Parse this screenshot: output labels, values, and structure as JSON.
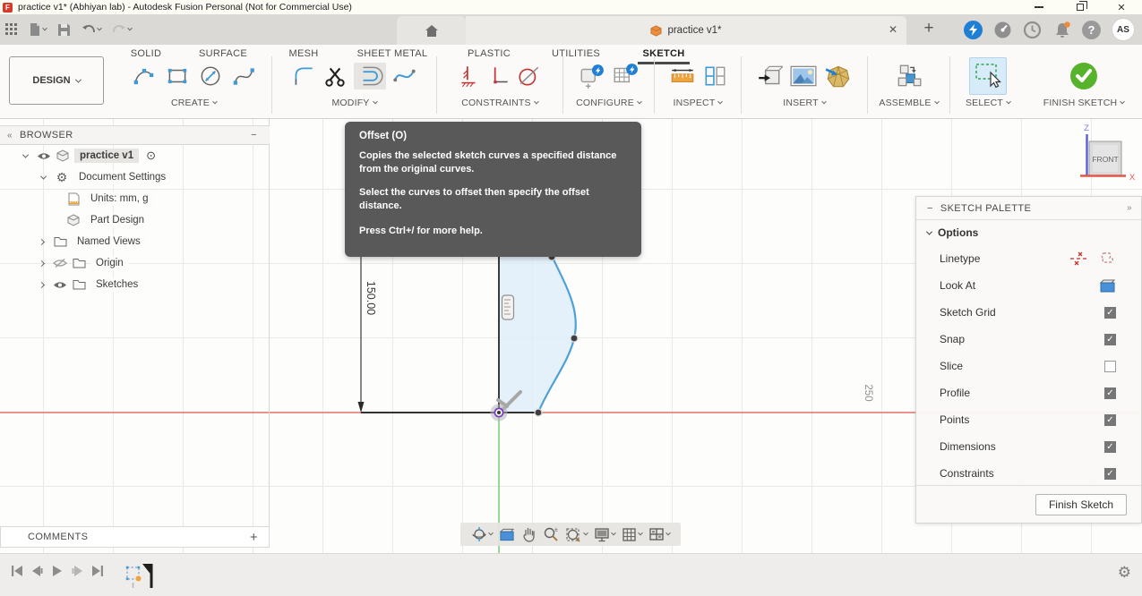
{
  "window": {
    "title": "practice v1* (Abhiyan lab) - Autodesk Fusion Personal (Not for Commercial Use)",
    "logo_letter": "F"
  },
  "tabbar": {
    "document_tab": "practice v1*",
    "close_glyph": "✕",
    "new_tab_glyph": "+",
    "help_glyph": "?",
    "avatar": "AS"
  },
  "ribbon": {
    "design_button": "DESIGN",
    "tabs": [
      {
        "label": "SOLID"
      },
      {
        "label": "SURFACE"
      },
      {
        "label": "MESH"
      },
      {
        "label": "SHEET METAL"
      },
      {
        "label": "PLASTIC"
      },
      {
        "label": "UTILITIES"
      },
      {
        "label": "SKETCH"
      }
    ],
    "active_tab": "SKETCH",
    "groups": [
      {
        "label": "CREATE"
      },
      {
        "label": "MODIFY"
      },
      {
        "label": "CONSTRAINTS"
      },
      {
        "label": "CONFIGURE"
      },
      {
        "label": "INSPECT"
      },
      {
        "label": "INSERT"
      },
      {
        "label": "ASSEMBLE"
      },
      {
        "label": "SELECT"
      },
      {
        "label": "FINISH SKETCH"
      }
    ]
  },
  "browser": {
    "header": "BROWSER",
    "collapse_glyph": "«",
    "minimize_glyph": "−",
    "target_glyph": "⊙",
    "gear_glyph": "⚙",
    "items": [
      {
        "label": "practice v1"
      },
      {
        "label": "Document Settings"
      },
      {
        "label": "Units: mm, g"
      },
      {
        "label": "Part Design"
      },
      {
        "label": "Named Views"
      },
      {
        "label": "Origin"
      },
      {
        "label": "Sketches"
      }
    ]
  },
  "tooltip": {
    "title": "Offset (O)",
    "body1": "Copies the selected sketch curves a specified distance from the original curves.",
    "body2": "Select the curves to offset then specify the offset distance.",
    "footer": "Press Ctrl+/ for more help."
  },
  "sketch_palette": {
    "header": "SKETCH PALETTE",
    "minus_glyph": "−",
    "expand_glyph": "»",
    "section": "Options",
    "rows": [
      {
        "label": "Linetype",
        "control": "linetype-icons",
        "checked": null
      },
      {
        "label": "Look At",
        "control": "lookat-icon",
        "checked": null
      },
      {
        "label": "Sketch Grid",
        "control": "checkbox",
        "checked": true
      },
      {
        "label": "Snap",
        "control": "checkbox",
        "checked": true
      },
      {
        "label": "Slice",
        "control": "checkbox",
        "checked": false
      },
      {
        "label": "Profile",
        "control": "checkbox",
        "checked": true
      },
      {
        "label": "Points",
        "control": "checkbox",
        "checked": true
      },
      {
        "label": "Dimensions",
        "control": "checkbox",
        "checked": true
      },
      {
        "label": "Constraints",
        "control": "checkbox",
        "checked": true
      }
    ],
    "finish_button": "Finish Sketch"
  },
  "canvas": {
    "dimension_label": "150.00",
    "axis_scale_label": "250",
    "viewcube": {
      "face": "FRONT",
      "axis_z": "Z",
      "axis_x": "X"
    }
  },
  "comments": {
    "header": "COMMENTS",
    "add_glyph": "+"
  },
  "colors": {
    "spline_blue": "#4ea0d6",
    "profile_fill": "#ddeefa",
    "axis_red": "#e25b50",
    "axis_green": "#7dd17d",
    "finish_green": "#57b32b",
    "select_highlight": "#d8ebf8",
    "tooltip_bg": "#595959",
    "origin_purple": "#7b3fc4"
  }
}
